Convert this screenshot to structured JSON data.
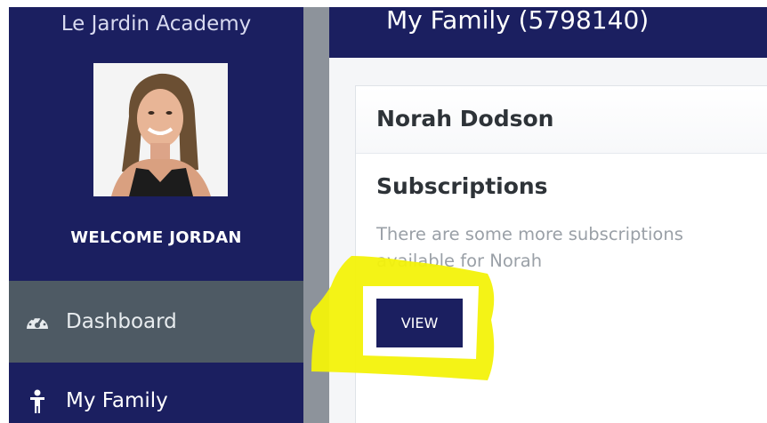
{
  "sidebar": {
    "school_name": "Le Jardin Academy",
    "welcome_text": "WELCOME JORDAN",
    "nav": [
      {
        "label": "Dashboard",
        "icon": "dashboard-gauge-icon",
        "active": true
      },
      {
        "label": "My Family",
        "icon": "person-icon",
        "active": false
      }
    ]
  },
  "header": {
    "title": "My Family (5798140)"
  },
  "card": {
    "student_name": "Norah Dodson",
    "section_title": "Subscriptions",
    "description": "There are some more subscriptions available for Norah",
    "button_label": "VIEW"
  },
  "colors": {
    "navy": "#1b1f60",
    "active_nav": "#4e5a64",
    "highlight": "#f3f20a"
  }
}
